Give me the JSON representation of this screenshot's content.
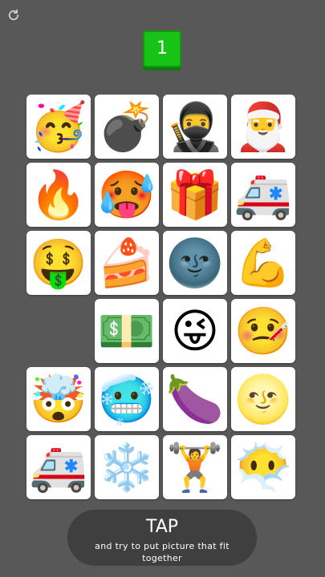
{
  "icons": {
    "refresh": "refresh-icon"
  },
  "score": {
    "value": "1"
  },
  "colors": {
    "background": "#585858",
    "score": "#17c317",
    "tile": "#ffffff",
    "tap_button": "#3f3f3f"
  },
  "grid": {
    "rows": [
      [
        "party-face",
        "bomb",
        "ninja",
        "santa"
      ],
      [
        "fire",
        "hot-devil-face",
        "gift",
        "ambulance"
      ],
      [
        "money-mouth-hand-face",
        "shortcake",
        "new-moon-face",
        "flexed-biceps"
      ],
      [
        "",
        "dollar-banknote",
        "winking-tongue-face",
        "thermometer-face"
      ],
      [
        "exploding-head",
        "cold-face",
        "eggplant",
        "full-moon-face"
      ],
      [
        "ambulance",
        "snowflake",
        "weight-lifter",
        "face-in-clouds"
      ]
    ],
    "glyphs": {
      "party-face": "🥳",
      "bomb": "💣",
      "ninja": "🥷",
      "santa": "🎅",
      "fire": "🔥",
      "hot-devil-face": "🥵",
      "gift": "🎁",
      "ambulance": "🚑",
      "money-mouth-hand-face": "🤑",
      "shortcake": "🍰",
      "new-moon-face": "🌚",
      "flexed-biceps": "💪",
      "dollar-banknote": "💵",
      "winking-tongue-face": "😜",
      "thermometer-face": "🤒",
      "exploding-head": "🤯",
      "cold-face": "🥶",
      "eggplant": "🍆",
      "full-moon-face": "🌝",
      "snowflake": "❄️",
      "weight-lifter": "🏋️",
      "face-in-clouds": "😶‍🌫️"
    }
  },
  "tap": {
    "title": "TAP",
    "subtitle": "and try to put picture that fit together"
  }
}
